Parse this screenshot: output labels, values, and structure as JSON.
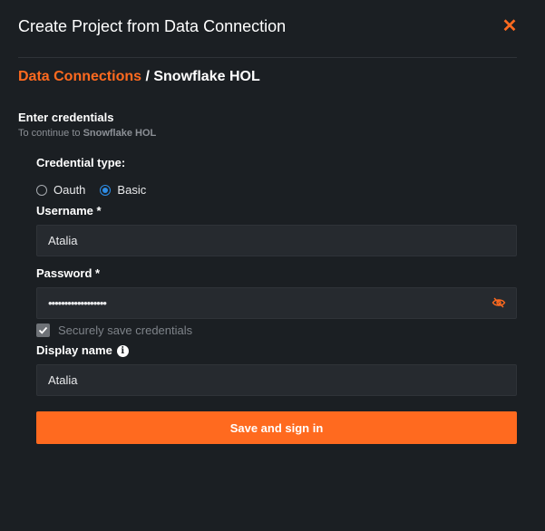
{
  "dialog": {
    "title": "Create Project from Data Connection",
    "close_icon": "close-icon"
  },
  "breadcrumb": {
    "link": "Data Connections",
    "separator": " / ",
    "current": "Snowflake HOL"
  },
  "credentials": {
    "title": "Enter credentials",
    "subtitle_prefix": "To continue to ",
    "subtitle_target": "Snowflake HOL"
  },
  "form": {
    "credential_type_label": "Credential type:",
    "credential_types": [
      {
        "label": "Oauth",
        "checked": false
      },
      {
        "label": "Basic",
        "checked": true
      }
    ],
    "username_label": "Username *",
    "username_value": "Atalia",
    "password_label": "Password *",
    "password_value": "••••••••••••••••••",
    "password_toggle_icon": "eye-off-icon",
    "save_credentials_label": "Securely save credentials",
    "save_credentials_checked": true,
    "display_name_label": "Display name",
    "display_name_info_icon": "info-icon",
    "display_name_value": "Atalia",
    "submit_label": "Save and sign in"
  },
  "colors": {
    "accent": "#ff6a1f",
    "background": "#1b1f23",
    "input_bg": "#262a2f",
    "radio_selected": "#2e8de6"
  }
}
